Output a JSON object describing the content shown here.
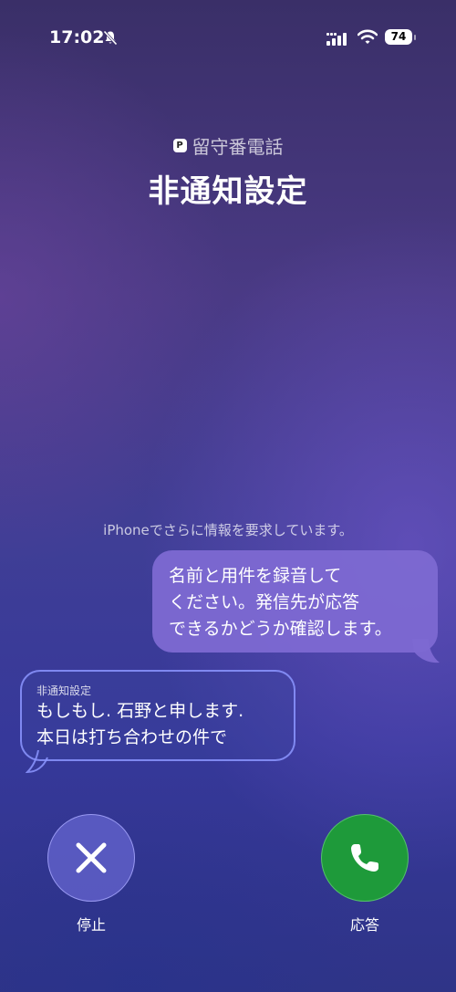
{
  "status_bar": {
    "time": "17:02",
    "battery": "74",
    "icons": [
      "mute-bell-icon",
      "cellular-signal-icon",
      "wifi-icon",
      "battery-icon"
    ]
  },
  "header": {
    "voicemail_badge": "P",
    "voicemail_label": "留守番電話",
    "caller": "非通知設定"
  },
  "transcript": {
    "info": "iPhoneでさらに情報を要求しています。",
    "outgoing_lines": [
      "名前と用件を録音して",
      "ください。発信先が応答",
      "できるかどうか確認します。"
    ],
    "incoming_sender": "非通知設定",
    "incoming_lines": [
      "もしもし. 石野と申します.",
      "本日は打ち合わせの件で"
    ]
  },
  "actions": {
    "stop_label": "停止",
    "answer_label": "応答",
    "colors": {
      "answer": "#1e9a3a",
      "stop": "#5f5fc8",
      "outgoing_bubble": "#7d69d2"
    }
  }
}
